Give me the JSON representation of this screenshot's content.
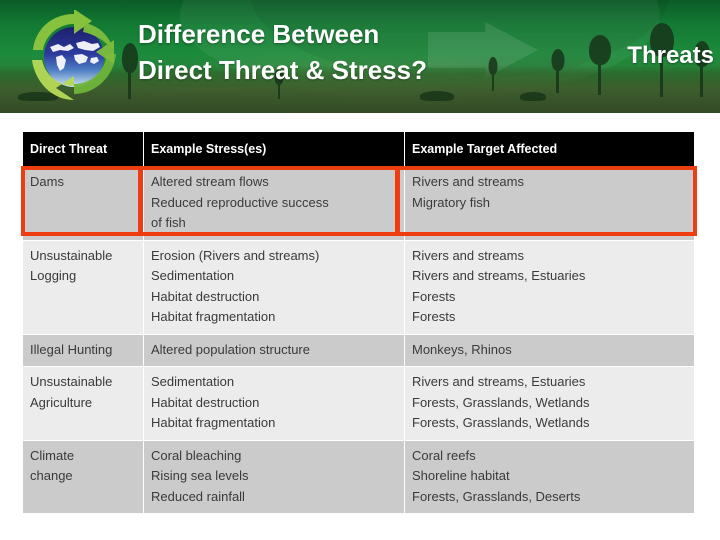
{
  "banner": {
    "title_line1": "Difference Between",
    "title_line2": "Direct Threat & Stress?",
    "section_label": "Threats",
    "logo_name": "recycling-globe-logo",
    "colors": {
      "green_dark": "#0a5c27",
      "green_mid": "#1d8b3c",
      "green_ground": "#2a5f29",
      "text": "#ffffff"
    }
  },
  "table": {
    "headers": [
      "Direct Threat",
      "Example Stress(es)",
      "Example Target Affected"
    ],
    "highlight_color": "#f03c11",
    "rows": [
      {
        "threat": [
          "Dams"
        ],
        "stresses": [
          "Altered stream flows",
          "Reduced reproductive success",
          "of fish"
        ],
        "targets": [
          "Rivers and streams",
          "Migratory fish"
        ],
        "highlighted": true
      },
      {
        "threat": [
          "Unsustainable",
          "Logging"
        ],
        "stresses": [
          "Erosion (Rivers and streams)",
          "Sedimentation",
          "Habitat destruction",
          "Habitat fragmentation"
        ],
        "targets": [
          "Rivers and streams",
          "Rivers and streams, Estuaries",
          "Forests",
          "Forests"
        ],
        "highlighted": false
      },
      {
        "threat": [
          "Illegal Hunting"
        ],
        "stresses": [
          "Altered population structure"
        ],
        "targets": [
          "Monkeys, Rhinos"
        ],
        "highlighted": false
      },
      {
        "threat": [
          "Unsustainable",
          "Agriculture"
        ],
        "stresses": [
          "Sedimentation",
          "Habitat destruction",
          "Habitat fragmentation"
        ],
        "targets": [
          "Rivers and streams, Estuaries",
          "Forests, Grasslands, Wetlands",
          "Forests, Grasslands, Wetlands"
        ],
        "highlighted": false
      },
      {
        "threat": [
          "Climate",
          "change"
        ],
        "stresses": [
          "Coral bleaching",
          "Rising sea levels",
          "Reduced rainfall"
        ],
        "targets": [
          "Coral reefs",
          "Shoreline habitat",
          "Forests, Grasslands, Deserts"
        ],
        "highlighted": false
      }
    ]
  }
}
